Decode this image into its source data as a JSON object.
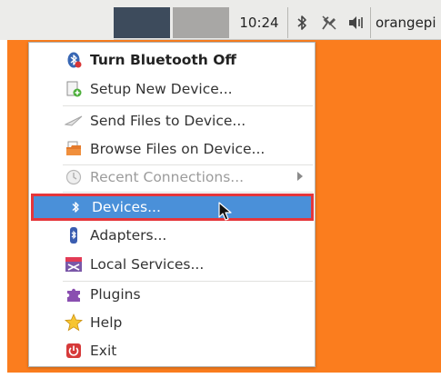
{
  "panel": {
    "clock": "10:24",
    "user": "orangepi",
    "tray_icons": [
      "bluetooth-icon",
      "network-disconnected-icon",
      "volume-icon"
    ]
  },
  "menu": {
    "items": [
      {
        "label": "Turn Bluetooth Off",
        "icon": "bluetooth-icon"
      },
      {
        "label": "Setup New Device...",
        "icon": "setup-device-icon"
      },
      {
        "label": "Send Files to Device...",
        "icon": "send-files-icon"
      },
      {
        "label": "Browse Files on Device...",
        "icon": "folder-icon"
      },
      {
        "label": "Recent Connections...",
        "icon": "recent-connections-icon"
      },
      {
        "label": "Devices...",
        "icon": "bluetooth-devices-icon"
      },
      {
        "label": "Adapters...",
        "icon": "adapter-icon"
      },
      {
        "label": "Local Services...",
        "icon": "local-services-icon"
      },
      {
        "label": "Plugins",
        "icon": "puzzle-icon"
      },
      {
        "label": "Help",
        "icon": "star-icon"
      },
      {
        "label": "Exit",
        "icon": "power-icon"
      }
    ],
    "selected_index": 5,
    "disabled_index": 4
  },
  "colors": {
    "desktop": "#fb7d1e",
    "selection": "#4a90d9",
    "highlight_border": "#e5363b"
  }
}
